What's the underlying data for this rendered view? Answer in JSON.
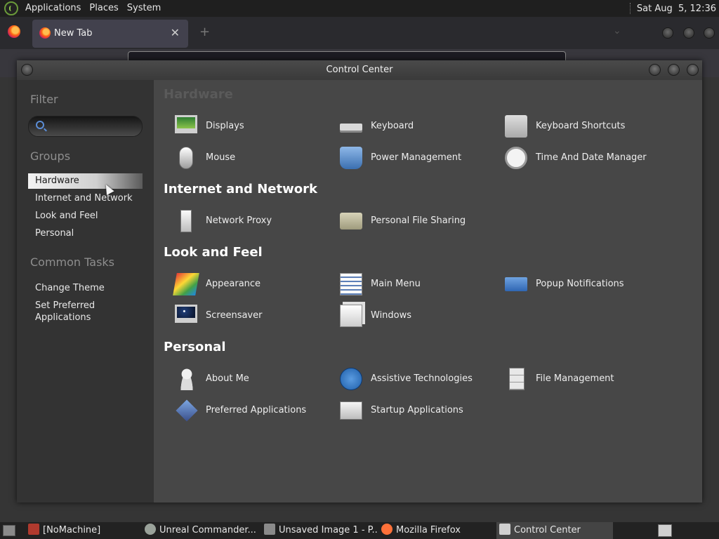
{
  "top_panel": {
    "menu": [
      "Applications",
      "Places",
      "System"
    ],
    "clock": "Sat Aug  5, 12:36"
  },
  "firefox": {
    "tab_label": "New Tab",
    "tab_close": "✕",
    "new_tab_glyph": "+"
  },
  "window": {
    "title": "Control Center"
  },
  "sidebar": {
    "filter_heading": "Filter",
    "filter_placeholder": "",
    "groups_heading": "Groups",
    "groups": [
      "Hardware",
      "Internet and Network",
      "Look and Feel",
      "Personal"
    ],
    "selected_group": "Hardware",
    "tasks_heading": "Common Tasks",
    "tasks": [
      "Change Theme",
      "Set Preferred Applications"
    ]
  },
  "main": {
    "groups": [
      {
        "title": "Hardware",
        "items": [
          {
            "label": "Displays",
            "icon": "displays-icon"
          },
          {
            "label": "Keyboard",
            "icon": "keyboard-icon"
          },
          {
            "label": "Keyboard Shortcuts",
            "icon": "keyboard-shortcuts-icon"
          },
          {
            "label": "Mouse",
            "icon": "mouse-icon"
          },
          {
            "label": "Power Management",
            "icon": "power-management-icon"
          },
          {
            "label": "Time And Date Manager",
            "icon": "clock-icon"
          }
        ]
      },
      {
        "title": "Internet and Network",
        "items": [
          {
            "label": "Network Proxy",
            "icon": "network-proxy-icon"
          },
          {
            "label": "Personal File Sharing",
            "icon": "file-sharing-icon"
          }
        ]
      },
      {
        "title": "Look and Feel",
        "items": [
          {
            "label": "Appearance",
            "icon": "appearance-icon"
          },
          {
            "label": "Main Menu",
            "icon": "main-menu-icon"
          },
          {
            "label": "Popup Notifications",
            "icon": "popup-notifications-icon"
          },
          {
            "label": "Screensaver",
            "icon": "screensaver-icon"
          },
          {
            "label": "Windows",
            "icon": "windows-icon"
          }
        ]
      },
      {
        "title": "Personal",
        "items": [
          {
            "label": "About Me",
            "icon": "about-me-icon"
          },
          {
            "label": "Assistive Technologies",
            "icon": "assistive-technologies-icon"
          },
          {
            "label": "File Management",
            "icon": "file-management-icon"
          },
          {
            "label": "Preferred Applications",
            "icon": "preferred-applications-icon"
          },
          {
            "label": "Startup Applications",
            "icon": "startup-applications-icon"
          }
        ]
      }
    ]
  },
  "taskbar": {
    "tasks": [
      {
        "label": "[NoMachine]",
        "icon": "nomachine-icon",
        "color": "#b03a2e"
      },
      {
        "label": "Unreal Commander...",
        "icon": "unreal-commander-icon",
        "color": "#9aa29a"
      },
      {
        "label": "Unsaved Image 1 - P...",
        "icon": "paint-icon",
        "color": "#8a8a8a"
      },
      {
        "label": "Mozilla Firefox",
        "icon": "firefox-icon",
        "color": "#ff7139"
      },
      {
        "label": "Control Center",
        "icon": "control-center-icon",
        "color": "#d0d0d0"
      }
    ],
    "active": "Control Center"
  }
}
